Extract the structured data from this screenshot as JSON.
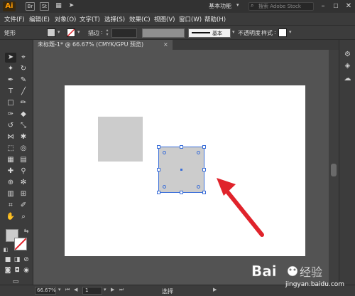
{
  "app": {
    "logo": "Ai",
    "workspace": "基本功能",
    "stock_search_placeholder": "搜索 Adobe Stock"
  },
  "menu": [
    "文件(F)",
    "编辑(E)",
    "对象(O)",
    "文字(T)",
    "选择(S)",
    "效果(C)",
    "视图(V)",
    "窗口(W)",
    "帮助(H)"
  ],
  "control_bar": {
    "selection_type": "矩形",
    "stroke_label": "描边",
    "stroke_style": "基本",
    "opacity_label": "不透明度",
    "style_label": "样式",
    "fill_color": "#cccccc"
  },
  "document_tab": {
    "title": "未标题-1* @ 66.67% (CMYK/GPU 预览)",
    "close": "×"
  },
  "status_bar": {
    "zoom": "66.67%",
    "page": "1",
    "status": "选择"
  },
  "watermark": {
    "brand": "Bai",
    "brand_suffix": "经验",
    "url": "jingyan.baidu.com"
  },
  "colors": {
    "accent_selection": "#3a6ed8",
    "arrow": "#e0232b",
    "artboard": "#ffffff",
    "shape_fill": "#cccccc"
  }
}
